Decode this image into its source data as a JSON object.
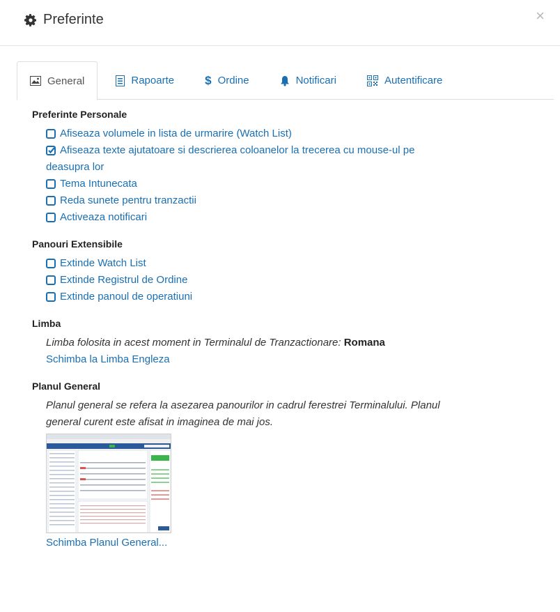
{
  "dialog": {
    "title": "Preferinte",
    "close_glyph": "×"
  },
  "tabs": [
    {
      "label": "General",
      "icon": "picture-icon",
      "active": true
    },
    {
      "label": "Rapoarte",
      "icon": "list-icon",
      "active": false
    },
    {
      "label": "Ordine",
      "icon": "dollar-icon",
      "active": false
    },
    {
      "label": "Notificari",
      "icon": "bell-icon",
      "active": false
    },
    {
      "label": "Autentificare",
      "icon": "qrcode-icon",
      "active": false
    }
  ],
  "personal": {
    "title": "Preferinte Personale",
    "options": [
      {
        "label": "Afiseaza volumele in lista de urmarire (Watch List)",
        "checked": false
      },
      {
        "label": "Afiseaza texte ajutatoare si descrierea coloanelor la trecerea cu mouse-ul pe",
        "label_cont": "deasupra lor",
        "checked": true
      },
      {
        "label": "Tema Intunecata",
        "checked": false
      },
      {
        "label": "Reda sunete pentru tranzactii",
        "checked": false
      },
      {
        "label": "Activeaza notificari",
        "checked": false
      }
    ]
  },
  "panels": {
    "title": "Panouri Extensibile",
    "options": [
      {
        "label": "Extinde Watch List",
        "checked": false
      },
      {
        "label": "Extinde Registrul de Ordine",
        "checked": false
      },
      {
        "label": "Extinde panoul de operatiuni",
        "checked": false
      }
    ]
  },
  "language": {
    "title": "Limba",
    "text": "Limba folosita in acest moment in Terminalul de Tranzactionare:",
    "current": "Romana",
    "switch_link": "Schimba la Limba Engleza"
  },
  "layout": {
    "title": "Planul General",
    "text_line1": "Planul general se refera la asezarea panourilor in cadrul ferestrei Terminalului. Planul",
    "text_line2": "general curent este afisat in imaginea de mai jos.",
    "change_link": "Schimba Planul General..."
  },
  "colors": {
    "link": "#1a6fb3",
    "text": "#333333",
    "border": "#dddddd"
  }
}
